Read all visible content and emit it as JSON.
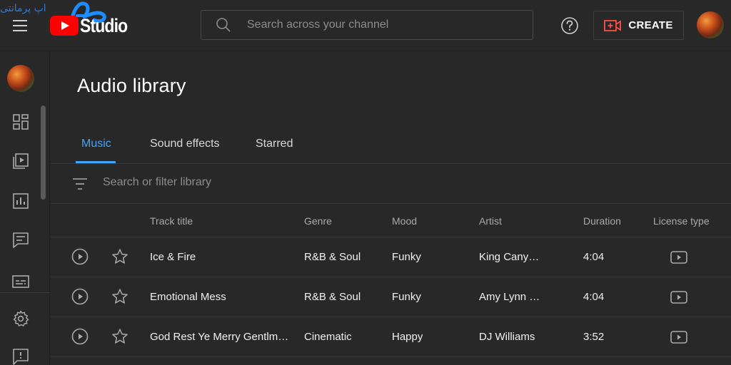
{
  "app": {
    "logo_text": "Studio",
    "watermark_text": "اپ پرمانتی"
  },
  "header": {
    "search_placeholder": "Search across your channel",
    "create_label": "CREATE"
  },
  "page": {
    "title": "Audio library"
  },
  "tabs": [
    {
      "label": "Music",
      "active": true
    },
    {
      "label": "Sound effects",
      "active": false
    },
    {
      "label": "Starred",
      "active": false
    }
  ],
  "filter": {
    "placeholder": "Search or filter library"
  },
  "table": {
    "columns": {
      "track_title": "Track title",
      "genre": "Genre",
      "mood": "Mood",
      "artist": "Artist",
      "duration": "Duration",
      "license_type": "License type"
    },
    "rows": [
      {
        "title": "Ice & Fire",
        "genre": "R&B & Soul",
        "mood": "Funky",
        "artist": "King Cany…",
        "duration": "4:04"
      },
      {
        "title": "Emotional Mess",
        "genre": "R&B & Soul",
        "mood": "Funky",
        "artist": "Amy Lynn …",
        "duration": "4:04"
      },
      {
        "title": "God Rest Ye Merry Gentlm…",
        "genre": "Cinematic",
        "mood": "Happy",
        "artist": "DJ Williams",
        "duration": "3:52"
      }
    ]
  },
  "colors": {
    "background": "#282828",
    "accent": "#3ea6ff",
    "youtube_red": "#ff0000",
    "create_icon": "#ff4e45"
  },
  "icons": {
    "menu": "hamburger-icon",
    "search": "search-icon",
    "help": "help-icon",
    "create": "create-video-icon",
    "dashboard": "dashboard-icon",
    "content": "content-icon",
    "analytics": "analytics-icon",
    "comments": "comments-icon",
    "subtitles": "subtitles-icon",
    "settings": "gear-icon",
    "feedback": "feedback-icon",
    "filter": "filter-icon",
    "play": "play-circle-icon",
    "star": "star-icon",
    "license": "youtube-license-icon"
  }
}
